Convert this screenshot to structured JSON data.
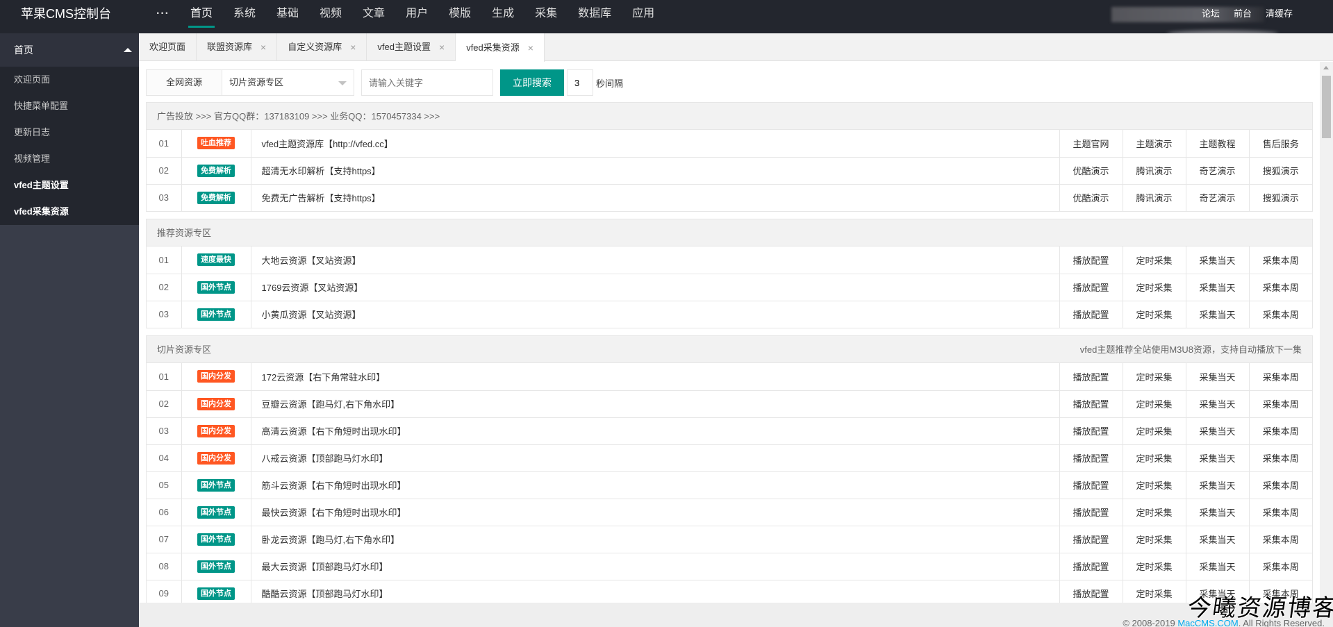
{
  "app": {
    "title": "苹果CMS控制台"
  },
  "topnav": {
    "more": "···",
    "items": [
      "首页",
      "系统",
      "基础",
      "视频",
      "文章",
      "用户",
      "模版",
      "生成",
      "采集",
      "数据库",
      "应用"
    ],
    "right": [
      "论坛",
      "前台",
      "清缓存"
    ]
  },
  "sidebar": {
    "head": "首页",
    "items": [
      "欢迎页面",
      "快捷菜单配置",
      "更新日志",
      "视频管理",
      "vfed主题设置",
      "vfed采集资源"
    ]
  },
  "tabs": [
    {
      "label": "欢迎页面"
    },
    {
      "label": "联盟资源库"
    },
    {
      "label": "自定义资源库"
    },
    {
      "label": "vfed主题设置"
    },
    {
      "label": "vfed采集资源"
    }
  ],
  "tab_close": "×",
  "search": {
    "left_label": "全网资源",
    "select_value": "切片资源专区",
    "keyword_placeholder": "请输入关键字",
    "button": "立即搜索",
    "interval": "3",
    "interval_label": "秒间隔"
  },
  "colors": {
    "accent": "#009688",
    "red": "#FF5722"
  },
  "sections": [
    {
      "title": "广告投放 >>> 官方QQ群：137183109 >>> 业务QQ：1570457334 >>>",
      "note": "",
      "rows": [
        {
          "idx": "01",
          "badge": "吐血推荐",
          "color": "#FF5722",
          "name": "vfed主题资源库【http://vfed.cc】",
          "actions": [
            "主题官网",
            "主题演示",
            "主题教程",
            "售后服务"
          ]
        },
        {
          "idx": "02",
          "badge": "免费解析",
          "color": "#009688",
          "name": "超清无水印解析【支持https】",
          "actions": [
            "优酷演示",
            "腾讯演示",
            "奇艺演示",
            "搜狐演示"
          ]
        },
        {
          "idx": "03",
          "badge": "免费解析",
          "color": "#009688",
          "name": "免费无广告解析【支持https】",
          "actions": [
            "优酷演示",
            "腾讯演示",
            "奇艺演示",
            "搜狐演示"
          ]
        }
      ]
    },
    {
      "title": "推荐资源专区",
      "note": "",
      "rows": [
        {
          "idx": "01",
          "badge": "速度最快",
          "color": "#009688",
          "name": "大地云资源【叉站资源】",
          "actions": [
            "播放配置",
            "定时采集",
            "采集当天",
            "采集本周"
          ]
        },
        {
          "idx": "02",
          "badge": "国外节点",
          "color": "#009688",
          "name": "1769云资源【叉站资源】",
          "actions": [
            "播放配置",
            "定时采集",
            "采集当天",
            "采集本周"
          ]
        },
        {
          "idx": "03",
          "badge": "国外节点",
          "color": "#009688",
          "name": "小黄瓜资源【叉站资源】",
          "actions": [
            "播放配置",
            "定时采集",
            "采集当天",
            "采集本周"
          ]
        }
      ]
    },
    {
      "title": "切片资源专区",
      "note": "vfed主题推荐全站使用M3U8资源，支持自动播放下一集",
      "rows": [
        {
          "idx": "01",
          "badge": "国内分发",
          "color": "#FF5722",
          "name": "172云资源【右下角常驻水印】",
          "actions": [
            "播放配置",
            "定时采集",
            "采集当天",
            "采集本周"
          ]
        },
        {
          "idx": "02",
          "badge": "国内分发",
          "color": "#FF5722",
          "name": "豆瓣云资源【跑马灯,右下角水印】",
          "actions": [
            "播放配置",
            "定时采集",
            "采集当天",
            "采集本周"
          ]
        },
        {
          "idx": "03",
          "badge": "国内分发",
          "color": "#FF5722",
          "name": "高清云资源【右下角短时出现水印】",
          "actions": [
            "播放配置",
            "定时采集",
            "采集当天",
            "采集本周"
          ]
        },
        {
          "idx": "04",
          "badge": "国内分发",
          "color": "#FF5722",
          "name": "八戒云资源【顶部跑马灯水印】",
          "actions": [
            "播放配置",
            "定时采集",
            "采集当天",
            "采集本周"
          ]
        },
        {
          "idx": "05",
          "badge": "国外节点",
          "color": "#009688",
          "name": "筋斗云资源【右下角短时出现水印】",
          "actions": [
            "播放配置",
            "定时采集",
            "采集当天",
            "采集本周"
          ]
        },
        {
          "idx": "06",
          "badge": "国外节点",
          "color": "#009688",
          "name": "最快云资源【右下角短时出现水印】",
          "actions": [
            "播放配置",
            "定时采集",
            "采集当天",
            "采集本周"
          ]
        },
        {
          "idx": "07",
          "badge": "国外节点",
          "color": "#009688",
          "name": "卧龙云资源【跑马灯,右下角水印】",
          "actions": [
            "播放配置",
            "定时采集",
            "采集当天",
            "采集本周"
          ]
        },
        {
          "idx": "08",
          "badge": "国外节点",
          "color": "#009688",
          "name": "最大云资源【顶部跑马灯水印】",
          "actions": [
            "播放配置",
            "定时采集",
            "采集当天",
            "采集本周"
          ]
        },
        {
          "idx": "09",
          "badge": "国外节点",
          "color": "#009688",
          "name": "酷酷云资源【顶部跑马灯水印】",
          "actions": [
            "播放配置",
            "定时采集",
            "采集当天",
            "采集本周"
          ]
        }
      ]
    }
  ],
  "footer": {
    "prefix": "© 2008-2019 ",
    "link": "MacCMS.COM",
    "suffix": ". All Rights Reserved."
  },
  "watermark": "今曦资源博客"
}
